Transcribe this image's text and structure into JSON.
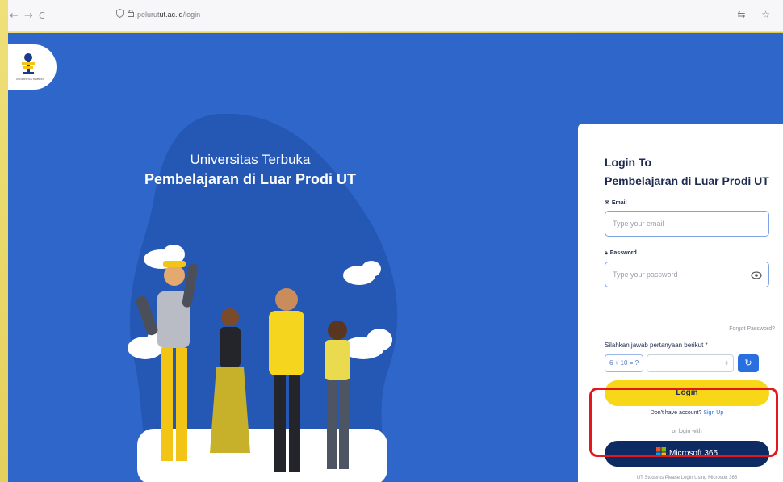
{
  "browser": {
    "back_icon": "←",
    "forward_icon": "→",
    "reload_icon": "C",
    "url_prefix": "pelurut",
    "url_domain": "ut.ac.id",
    "url_path": "/login",
    "right_icons": "⇆ ☆"
  },
  "logo": {
    "caption": "UNIVERSITAS TERBUKA"
  },
  "hero": {
    "line1": "Universitas Terbuka",
    "line2": "Pembelajaran di Luar Prodi UT"
  },
  "login": {
    "title_line1": "Login To",
    "title_line2": "Pembelajaran di Luar Prodi UT",
    "email_label": "Email",
    "email_placeholder": "Type your email",
    "password_label": "Password",
    "password_placeholder": "Type your password",
    "forgot": "Forgot Password?",
    "captcha_question": "Silahkan jawab pertanyaan berikut *",
    "captcha_expr": "6 + 10 = ?",
    "login_button": "Login",
    "signup_prefix": "Don't have account?",
    "signup_link": "Sign Up",
    "or_text": "or login with",
    "microsoft_button": "Microsoft 365",
    "note": "UT Students Please Login Using Microsoft 365"
  },
  "colors": {
    "page_bg": "#2f66c9",
    "login_yellow": "#f8d719",
    "ms_navy": "#0e2a63",
    "highlight_red": "#e4161e"
  }
}
